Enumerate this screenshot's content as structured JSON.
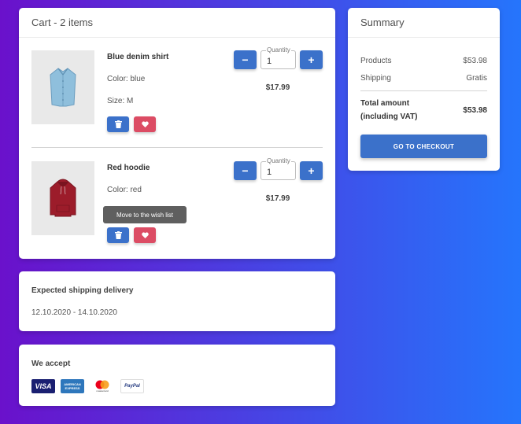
{
  "cart": {
    "title": "Cart - 2 items",
    "items": [
      {
        "name": "Blue denim shirt",
        "color": "Color: blue",
        "size": "Size: M",
        "quantity_label": "Quantity",
        "quantity": "1",
        "price": "$17.99",
        "minus": "−",
        "plus": "+"
      },
      {
        "name": "Red hoodie",
        "color": "Color: red",
        "quantity_label": "Quantity",
        "quantity": "1",
        "price": "$17.99",
        "minus": "−",
        "plus": "+"
      }
    ],
    "tooltip": "Move to the wish list",
    "icons": {
      "delete": "trash-icon",
      "wishlist": "heart-icon"
    }
  },
  "shipping": {
    "title": "Expected shipping delivery",
    "dates": "12.10.2020 - 14.10.2020"
  },
  "payments": {
    "title": "We accept",
    "logos": [
      {
        "name": "visa-logo",
        "text": "VISA"
      },
      {
        "name": "amex-logo",
        "text": "AMERICAN EXPRESS"
      },
      {
        "name": "mastercard-logo",
        "text": "mastercard"
      },
      {
        "name": "paypal-logo",
        "text": "PayPal"
      }
    ]
  },
  "summary": {
    "title": "Summary",
    "products_label": "Products",
    "products_value": "$53.98",
    "shipping_label": "Shipping",
    "shipping_value": "Gratis",
    "total_label_1": "Total amount",
    "total_label_2": "(including VAT)",
    "total_value": "$53.98",
    "checkout": "GO TO CHECKOUT"
  },
  "colors": {
    "primary": "#3b71ca",
    "danger": "#dc4c64",
    "gradient_start": "#6a11cb",
    "gradient_end": "#2575fc"
  }
}
